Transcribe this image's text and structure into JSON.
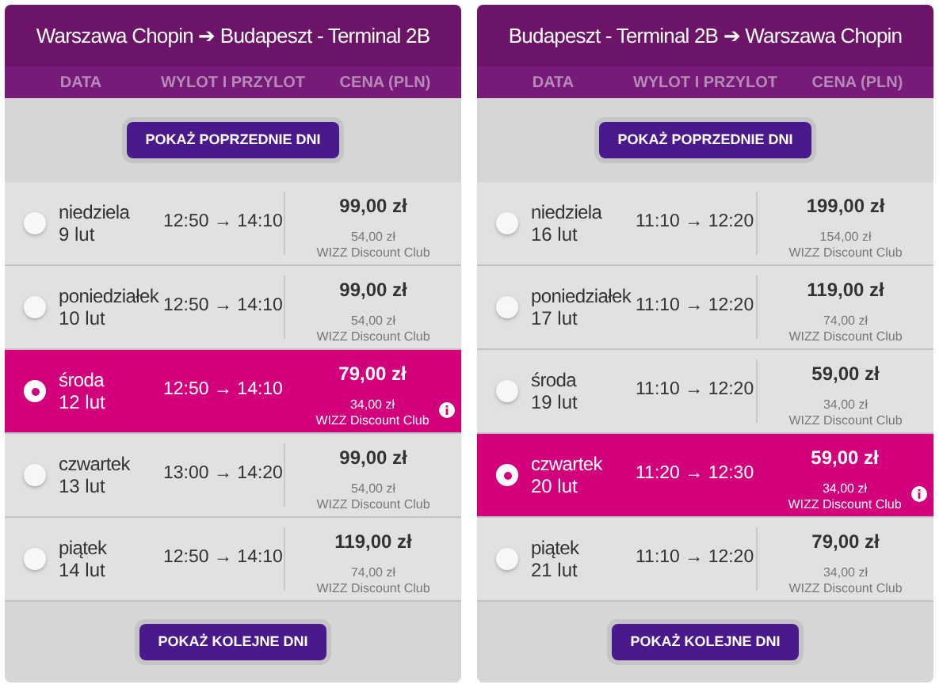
{
  "panels": [
    {
      "title": "Warszawa Chopin ➔ Budapeszt - Terminal 2B",
      "columns": [
        "DATA",
        "WYLOT I PRZYLOT",
        "CENA (PLN)"
      ],
      "prev_button": "POKAŻ POPRZEDNIE DNI",
      "next_button": "POKAŻ KOLEJNE DNI",
      "days": [
        {
          "weekday": "niedziela",
          "date": "9 lut",
          "times": "12:50 → 14:10",
          "price": "99,00 zł",
          "club_price": "54,00 zł",
          "club": "WIZZ Discount Club",
          "selected": false
        },
        {
          "weekday": "poniedziałek",
          "date": "10 lut",
          "times": "12:50 → 14:10",
          "price": "99,00 zł",
          "club_price": "54,00 zł",
          "club": "WIZZ Discount Club",
          "selected": false
        },
        {
          "weekday": "środa",
          "date": "12 lut",
          "times": "12:50 → 14:10",
          "price": "79,00 zł",
          "club_price": "34,00 zł",
          "club": "WIZZ Discount Club",
          "selected": true
        },
        {
          "weekday": "czwartek",
          "date": "13 lut",
          "times": "13:00 → 14:20",
          "price": "99,00 zł",
          "club_price": "54,00 zł",
          "club": "WIZZ Discount Club",
          "selected": false
        },
        {
          "weekday": "piątek",
          "date": "14 lut",
          "times": "12:50 → 14:10",
          "price": "119,00 zł",
          "club_price": "74,00 zł",
          "club": "WIZZ Discount Club",
          "selected": false
        }
      ]
    },
    {
      "title": "Budapeszt - Terminal 2B ➔ Warszawa Chopin",
      "columns": [
        "DATA",
        "WYLOT I PRZYLOT",
        "CENA (PLN)"
      ],
      "prev_button": "POKAŻ POPRZEDNIE DNI",
      "next_button": "POKAŻ KOLEJNE DNI",
      "days": [
        {
          "weekday": "niedziela",
          "date": "16 lut",
          "times": "11:10 → 12:20",
          "price": "199,00 zł",
          "club_price": "154,00 zł",
          "club": "WIZZ Discount Club",
          "selected": false
        },
        {
          "weekday": "poniedziałek",
          "date": "17 lut",
          "times": "11:10 → 12:20",
          "price": "119,00 zł",
          "club_price": "74,00 zł",
          "club": "WIZZ Discount Club",
          "selected": false
        },
        {
          "weekday": "środa",
          "date": "19 lut",
          "times": "11:10 → 12:20",
          "price": "59,00 zł",
          "club_price": "34,00 zł",
          "club": "WIZZ Discount Club",
          "selected": false
        },
        {
          "weekday": "czwartek",
          "date": "20 lut",
          "times": "11:20 → 12:30",
          "price": "59,00 zł",
          "club_price": "34,00 zł",
          "club": "WIZZ Discount Club",
          "selected": true
        },
        {
          "weekday": "piątek",
          "date": "21 lut",
          "times": "11:10 → 12:20",
          "price": "79,00 zł",
          "club_price": "34,00 zł",
          "club": "WIZZ Discount Club",
          "selected": false
        }
      ]
    }
  ]
}
